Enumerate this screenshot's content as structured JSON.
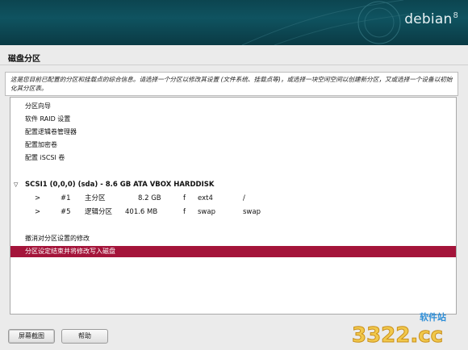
{
  "header": {
    "brand": "debian",
    "version": "8"
  },
  "page": {
    "title": "磁盘分区",
    "description": "这是您目前已配置的分区和挂载点的综合信息。请选择一个分区以修改其设置 (文件系统、挂载点等)，或选择一块空闲空间以创建新分区，又或选择一个设备以初始化其分区表。"
  },
  "menu": {
    "items": [
      "分区向导",
      "软件 RAID 设置",
      "配置逻辑卷管理器",
      "配置加密卷",
      "配置 iSCSI 卷"
    ]
  },
  "disk": {
    "label": "SCSI1 (0,0,0) (sda) - 8.6 GB ATA VBOX HARDDISK",
    "expander": "▽",
    "partitions": [
      {
        "arrow": ">",
        "num": "#1",
        "type": "主分区",
        "size": "8.2 GB",
        "flag": "f",
        "fs": "ext4",
        "mount": "/"
      },
      {
        "arrow": ">",
        "num": "#5",
        "type": "逻辑分区",
        "size": "401.6 MB",
        "flag": "f",
        "fs": "swap",
        "mount": "swap"
      }
    ]
  },
  "actions": {
    "undo": "撤消对分区设置的修改",
    "finish": "分区设定结束并将修改写入磁盘"
  },
  "buttons": {
    "screenshot": "屏幕截图",
    "help": "帮助"
  },
  "watermark": {
    "text": "软件站",
    "logo": "3322.cc"
  },
  "colors": {
    "selection": "#a4143a",
    "header": "#0f5360"
  }
}
